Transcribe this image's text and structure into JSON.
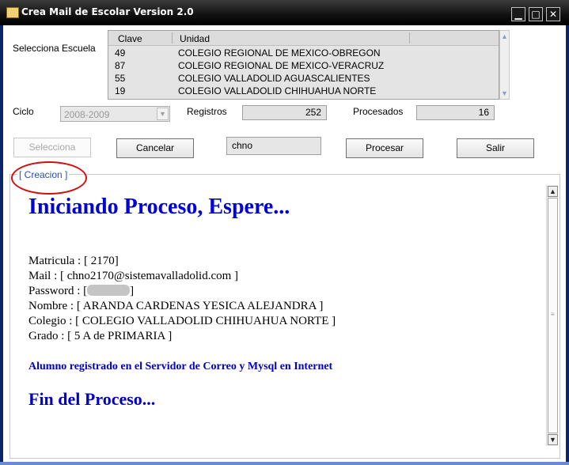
{
  "window": {
    "title": "Crea Mail de Escolar Version 2.0",
    "minimize": "▁",
    "maximize": "□",
    "close": "✕"
  },
  "form": {
    "escuela_label": "Selecciona Escuela",
    "list": {
      "headers": [
        "Clave",
        "Unidad"
      ],
      "rows": [
        [
          "49",
          "COLEGIO REGIONAL DE MEXICO-OBREGON"
        ],
        [
          "87",
          "COLEGIO REGIONAL DE MEXICO-VERACRUZ"
        ],
        [
          "55",
          "COLEGIO VALLADOLID AGUASCALIENTES"
        ],
        [
          "19",
          "COLEGIO VALLADOLID CHIHUAHUA NORTE"
        ]
      ]
    },
    "ciclo_label": "Ciclo",
    "ciclo_value": "2008-2009",
    "registros_label": "Registros",
    "registros_value": "252",
    "procesados_label": "Procesados",
    "procesados_value": "16",
    "buttons": {
      "selecciona": "Selecciona",
      "cancelar": "Cancelar",
      "procesar": "Procesar",
      "salir": "Salir"
    },
    "prefix_input": "chno"
  },
  "creacion": {
    "group_title": "[ Creacion ]",
    "heading": "Iniciando Proceso, Espere...",
    "matricula": "Matricula : [ 2170]",
    "mail": "Mail : [ chno2170@sistemavalladolid.com ]",
    "password_prefix": "Password : [",
    "password_suffix": "]",
    "nombre": "Nombre : [ ARANDA CARDENAS YESICA ALEJANDRA ]",
    "colegio": "Colegio : [ COLEGIO VALLADOLID CHIHUAHUA NORTE ]",
    "grado": "Grado : [ 5 A de PRIMARIA ]",
    "registrado": "Alumno registrado en el Servidor de Correo y Mysql en Internet",
    "fin": "Fin del Proceso..."
  },
  "icons": [
    "app-icon",
    "dropdown-arrow-icon",
    "scroll-up-icon",
    "scroll-down-icon"
  ]
}
